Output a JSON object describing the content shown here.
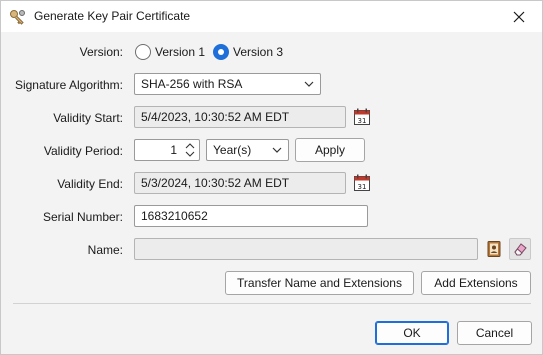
{
  "window": {
    "title": "Generate Key Pair Certificate"
  },
  "version": {
    "label": "Version:",
    "options": [
      "Version 1",
      "Version 3"
    ],
    "selected": "Version 3"
  },
  "signature": {
    "label": "Signature Algorithm:",
    "value": "SHA-256 with RSA"
  },
  "validity_start": {
    "label": "Validity Start:",
    "value": "5/4/2023, 10:30:52 AM EDT"
  },
  "validity_period": {
    "label": "Validity Period:",
    "amount": "1",
    "unit": "Year(s)",
    "apply_label": "Apply"
  },
  "validity_end": {
    "label": "Validity End:",
    "value": "5/3/2024, 10:30:52 AM EDT"
  },
  "serial": {
    "label": "Serial Number:",
    "value": "1683210652"
  },
  "name": {
    "label": "Name:",
    "value": ""
  },
  "buttons": {
    "transfer": "Transfer Name and Extensions",
    "add_extensions": "Add Extensions",
    "ok": "OK",
    "cancel": "Cancel"
  },
  "colors": {
    "accent": "#1e6fd9",
    "calendar_red": "#c0392b"
  },
  "icons": {
    "app": "key-pair-icon",
    "calendar": "calendar-icon",
    "address_book": "address-book-icon",
    "eraser": "eraser-icon"
  }
}
